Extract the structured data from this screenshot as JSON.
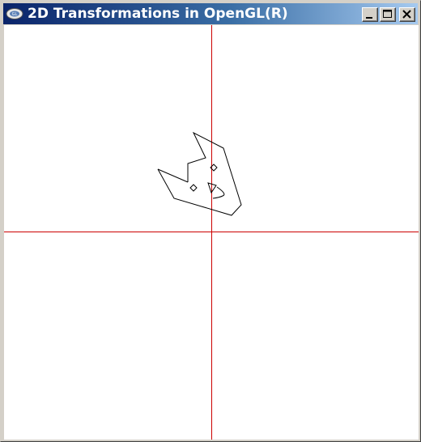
{
  "window": {
    "title": "2D Transformations in OpenGL(R)",
    "app_icon": "opengl-app-icon",
    "buttons": {
      "minimize_icon": "minimize-icon",
      "maximize_icon": "maximize-icon",
      "close_icon": "close-icon"
    }
  },
  "canvas": {
    "background_color": "#ffffff",
    "axis_color": "#cc0000",
    "shape_color": "#000000",
    "description_items": [
      "x-axis",
      "y-axis",
      "transformed-face-shape"
    ]
  },
  "colors": {
    "titlebar_start": "#0a246a",
    "titlebar_end": "#a6caf0",
    "chrome": "#d4d0c8"
  }
}
